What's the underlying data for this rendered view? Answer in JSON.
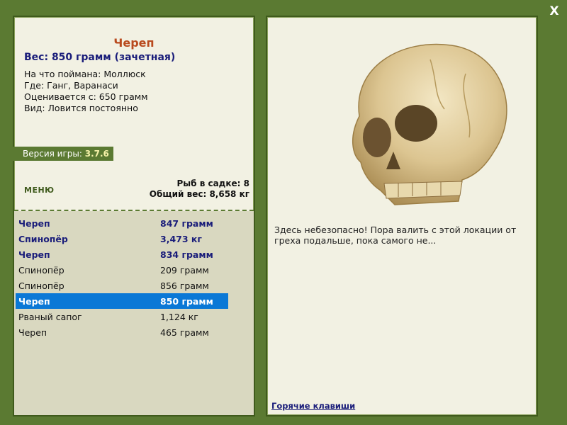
{
  "close_label": "X",
  "fish": {
    "title": "Череп",
    "weight": "Вес: 850 грамм (зачетная)",
    "info": [
      "На что поймана: Моллюск",
      "Где: Ганг, Варанаси",
      "Оценивается с: 650 грамм",
      "Вид: Ловится постоянно"
    ]
  },
  "version": {
    "label": "Версия игры:",
    "value": "3.7.6"
  },
  "menu_label": "МЕНЮ",
  "stats": {
    "in_net": "Рыб в садке: 8",
    "total_weight": "Общий вес: 8,658 кг"
  },
  "catch_list": [
    {
      "name": "Череп",
      "weight": "847 грамм",
      "style": "bold"
    },
    {
      "name": "Спинопёр",
      "weight": "3,473 кг",
      "style": "bold"
    },
    {
      "name": "Череп",
      "weight": "834 грамм",
      "style": "bold"
    },
    {
      "name": "Спинопёр",
      "weight": "209 грамм",
      "style": "normal"
    },
    {
      "name": "Спинопёр",
      "weight": "856 грамм",
      "style": "normal"
    },
    {
      "name": "Череп",
      "weight": "850 грамм",
      "style": "selected"
    },
    {
      "name": "Рваный сапог",
      "weight": "1,124 кг",
      "style": "normal"
    },
    {
      "name": "Череп",
      "weight": "465 грамм",
      "style": "normal"
    }
  ],
  "description": "Здесь небезопасно! Пора валить с этой локации от греха подальше, пока самого не...",
  "hotkeys_label": "Горячие клавиши",
  "colors": {
    "frame": "#5b7a32",
    "panel": "#f2f1e3",
    "list_bg": "#d9d8c0",
    "selected": "#0a78d6",
    "title": "#b94a1e",
    "accent_text": "#1a1d7a"
  }
}
